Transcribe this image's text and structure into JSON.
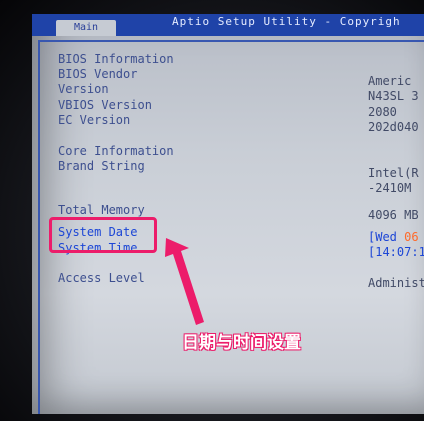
{
  "title_bar": {
    "text": "Aptio Setup Utility - Copyrigh",
    "tab": "Main"
  },
  "rows": {
    "bios_information": "BIOS Information",
    "bios_vendor": "BIOS Vendor",
    "bios_vendor_value": "Americ",
    "version": "Version",
    "version_value": "N43SL 3",
    "vbios_version": "VBIOS Version",
    "vbios_version_value": "2080",
    "ec_version": "EC Version",
    "ec_version_value": "202d040",
    "core_information": "Core Information",
    "brand_string": "Brand String",
    "brand_string_value_line1": "Intel(R",
    "brand_string_value_line2": "-2410M ",
    "total_memory": "Total Memory",
    "total_memory_value": "4096 MB",
    "system_date": "System Date",
    "system_date_value_prefix": "[Wed ",
    "system_date_value_highlight": "06",
    "system_time": "System Time",
    "system_time_value": "[14:07:1",
    "access_level": "Access Level",
    "access_level_value": "Administ"
  },
  "annotation": {
    "label": "日期与时间设置",
    "color": "#ec1c6a"
  },
  "colors": {
    "title_bar": "#1f43a8",
    "selected_text": "#1c46d6",
    "label_text": "#3d4f8f"
  }
}
